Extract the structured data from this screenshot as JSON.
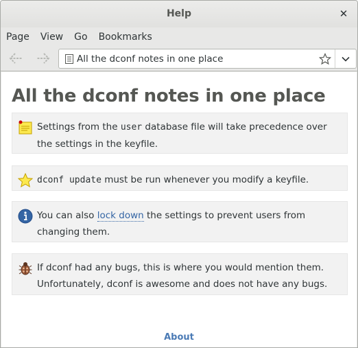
{
  "window": {
    "title": "Help"
  },
  "menubar": {
    "items": [
      "Page",
      "View",
      "Go",
      "Bookmarks"
    ]
  },
  "location": {
    "text": "All the dconf notes in one place"
  },
  "page": {
    "heading": "All the dconf notes in one place",
    "notes": [
      {
        "icon": "sticky-note-icon",
        "pre": "Settings from the ",
        "code": "user",
        "post": " database file will take precedence over the settings in the keyfile."
      },
      {
        "icon": "star-icon",
        "code": "dconf update",
        "post": " must be run whenever you modify a keyfile."
      },
      {
        "icon": "info-icon",
        "pre": "You can also ",
        "link": "lock down",
        "post": " the settings to prevent users from changing them."
      },
      {
        "icon": "bug-icon",
        "text": "If dconf had any bugs, this is where you would mention them. Unfortunately, dconf is awesome and does not have any bugs."
      }
    ],
    "footer_link": "About"
  },
  "colors": {
    "link": "#3465a4",
    "note_bg": "#f2f2f2",
    "heading": "#555753"
  }
}
